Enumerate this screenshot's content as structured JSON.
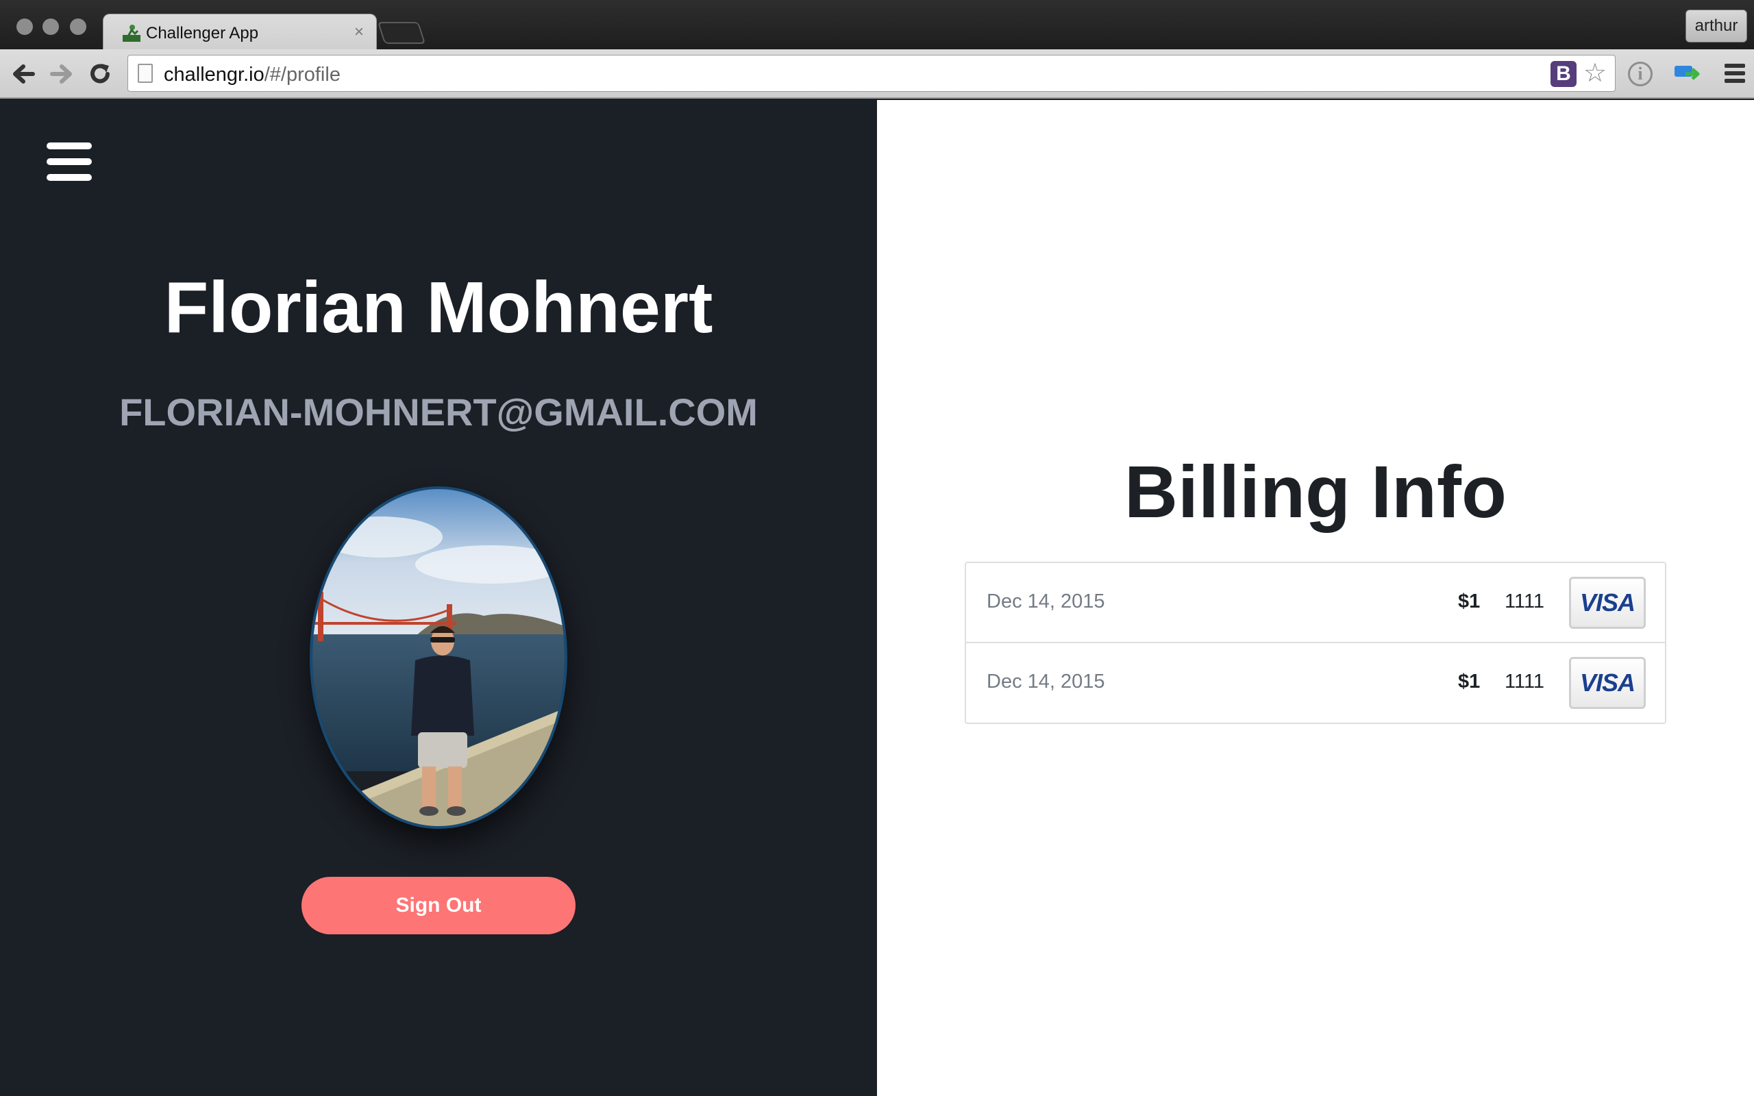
{
  "browser": {
    "tab_title": "Challenger App",
    "tab_close": "×",
    "profile_name": "arthur",
    "url_host": "challengr.io",
    "url_path": "/#/profile",
    "extension_b_label": "B",
    "info_icon_label": "i",
    "back_glyph": "🡐",
    "forward_glyph": "🡒",
    "reload_glyph": "↻",
    "star_glyph": "☆"
  },
  "profile": {
    "name": "Florian Mohnert",
    "email": "FLORIAN-MOHNERT@GMAIL.COM",
    "sign_out_label": "Sign Out"
  },
  "billing": {
    "title": "Billing Info",
    "rows": [
      {
        "date": "Dec 14, 2015",
        "amount": "$1",
        "last4": "1111",
        "card_brand": "VISA"
      },
      {
        "date": "Dec 14, 2015",
        "amount": "$1",
        "last4": "1111",
        "card_brand": "VISA"
      }
    ]
  },
  "colors": {
    "sidebar_bg": "#1b1f26",
    "signout_bg": "#fd7575",
    "email_color": "#9fa4b2",
    "visa_blue": "#1a3f8f"
  }
}
